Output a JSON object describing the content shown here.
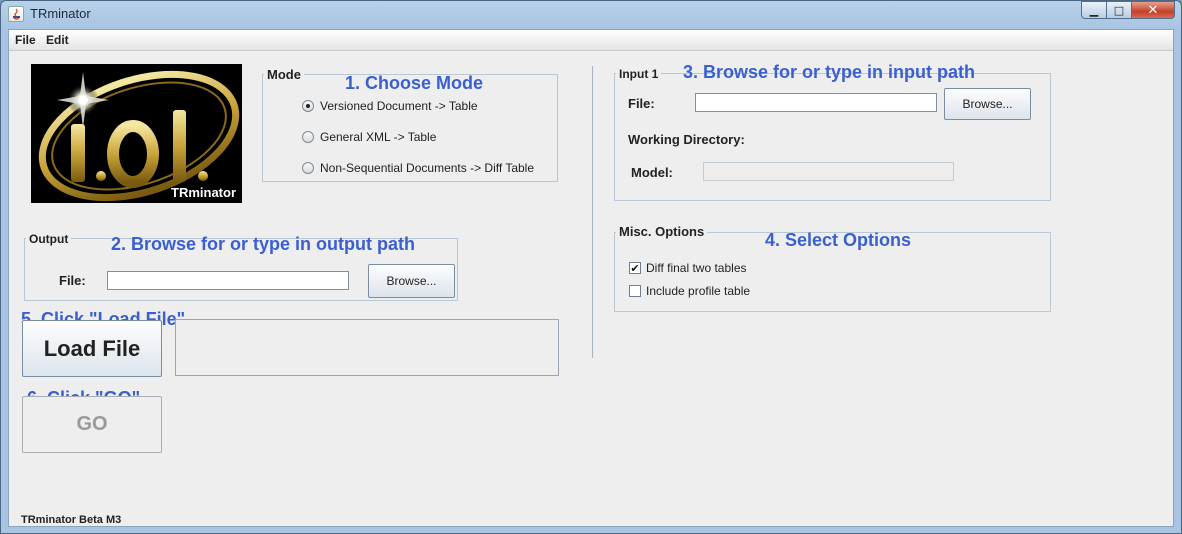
{
  "window": {
    "title": "TRminator",
    "minimize_glyph": "▁",
    "maximize_glyph": "□",
    "close_glyph": "✕"
  },
  "menu": {
    "file": "File",
    "edit": "Edit"
  },
  "logo": {
    "caption": "TRminator"
  },
  "mode": {
    "title": "Mode",
    "annotation": "1. Choose Mode",
    "options": [
      {
        "label": "Versioned Document -> Table",
        "selected": true
      },
      {
        "label": "General XML -> Table",
        "selected": false
      },
      {
        "label": "Non-Sequential Documents -> Diff Table",
        "selected": false
      }
    ]
  },
  "output": {
    "title": "Output",
    "annotation": "2. Browse for or type in output path",
    "file_label": "File:",
    "file_value": "",
    "browse_label": "Browse..."
  },
  "load": {
    "annotation": "5. Click \"Load File\"",
    "button_label": "Load File"
  },
  "go": {
    "annotation": "6. Click \"GO\"",
    "button_label": "GO"
  },
  "input1": {
    "title": "Input 1",
    "annotation": "3. Browse for or type in input  path",
    "file_label": "File:",
    "file_value": "",
    "browse_label": "Browse...",
    "working_dir_label": "Working Directory:",
    "model_label": "Model:",
    "model_value": ""
  },
  "misc": {
    "title": "Misc. Options",
    "annotation": "4. Select Options",
    "options": [
      {
        "label": "Diff final two tables",
        "checked": true,
        "mark": "✔"
      },
      {
        "label": "Include profile table",
        "checked": false,
        "mark": ""
      }
    ]
  },
  "status": {
    "text": "TRminator Beta M3"
  },
  "colors": {
    "annotation": "#3a5fd0",
    "window_frame": "#b9d1ea",
    "panel": "#eeeeee"
  }
}
